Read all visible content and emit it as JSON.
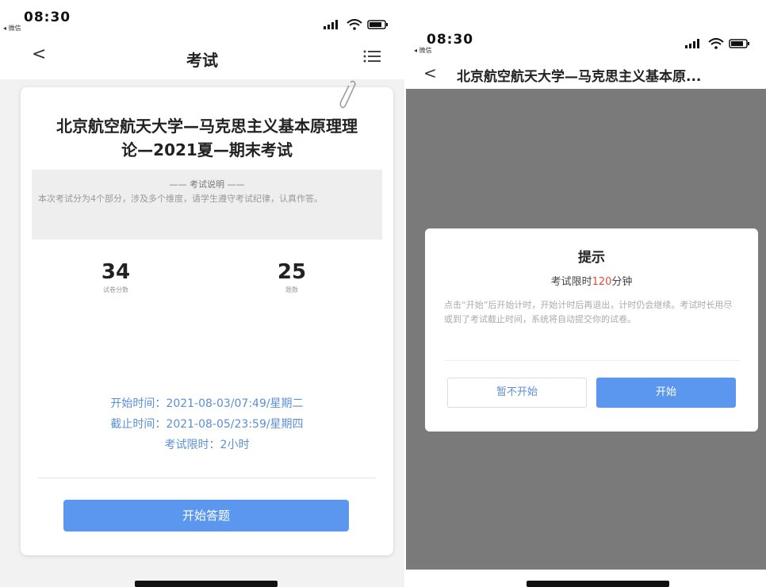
{
  "left": {
    "status": {
      "time": "08:30",
      "back_app": "◂ 微信"
    },
    "nav": {
      "title": "考试"
    },
    "exam": {
      "title_line1": "北京航空航天大学—马克思主义基本原理理",
      "title_line2": "论—2021夏—期末考试",
      "desc_heading": "—— 考试说明 ——",
      "desc_text": "本次考试分为4个部分，涉及多个维度，请学生遵守考试纪律，认真作答。",
      "score_value": "34",
      "score_label": "试卷分数",
      "count_value": "25",
      "count_label": "题数",
      "start_time": "开始时间：2021-08-03/07:49/星期二",
      "end_time": "截止时间：2021-08-05/23:59/星期四",
      "limit_time": "考试限时：2小时",
      "start_button": "开始答题"
    }
  },
  "right": {
    "status": {
      "time": "08:30",
      "back_app": "◂ 微信"
    },
    "nav": {
      "title": "北京航空航天大学—马克思主义基本原..."
    },
    "dialog": {
      "title": "提示",
      "limit_prefix": "考试限时",
      "limit_value": "120",
      "limit_suffix": "分钟",
      "body": "点击“开始”后开始计时，开始计时后再退出，计时仍会继续。考试时长用尽或到了考试截止时间，系统将自动提交你的试卷。",
      "later_button": "暂不开始",
      "start_button": "开始"
    }
  },
  "colors": {
    "accent": "#5b97ee",
    "time_text": "#5b8fd8",
    "highlight": "#e8473b",
    "overlay": "#7a7a7a"
  },
  "icons": [
    "signal-icon",
    "wifi-icon",
    "battery-icon",
    "back-chevron-icon",
    "menu-list-icon",
    "paperclip-icon"
  ]
}
